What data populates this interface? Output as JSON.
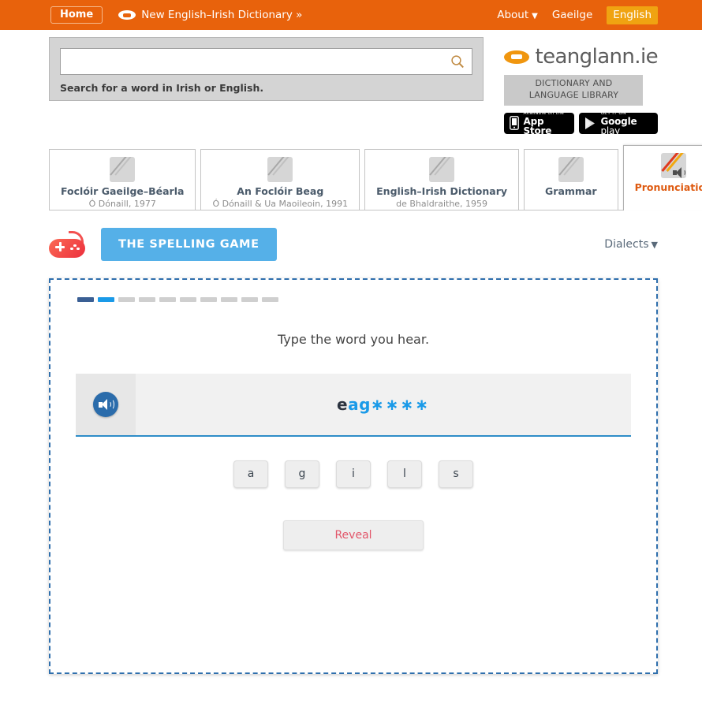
{
  "topbar": {
    "home_label": "Home",
    "breadcrumb_label": "New English–Irish Dictionary »",
    "about_label": "About",
    "about_caret": "▼",
    "lang_irish": "Gaeilge",
    "lang_english": "English",
    "bg_color": "#e8620c",
    "lang_active_color": "#f0a311"
  },
  "search": {
    "value": "",
    "placeholder": "",
    "hint": "Search for a word in Irish or English."
  },
  "brand": {
    "name": "teanglann.ie",
    "subtitle": "DICTIONARY AND LANGUAGE LIBRARY",
    "stores": [
      {
        "small": "Available on the",
        "big_bold": "App Store",
        "big_light": ""
      },
      {
        "small": "GET IT ON",
        "big_bold": "Google",
        "big_light": " play"
      }
    ]
  },
  "tabs": [
    {
      "name": "Foclóir Gaeilge–Béarla",
      "sub": "Ó Dónaill, 1977",
      "active": false
    },
    {
      "name": "An Foclóir Beag",
      "sub": "Ó Dónaill & Ua Maoileoin, 1991",
      "active": false
    },
    {
      "name": "English–Irish Dictionary",
      "sub": "de Bhaldraithe, 1959",
      "active": false
    },
    {
      "name": "Grammar",
      "sub": "",
      "active": false
    },
    {
      "name": "Pronunciation",
      "sub": "",
      "active": true
    }
  ],
  "game_header": {
    "button_label": "THE SPELLING GAME",
    "button_color": "#55b0e8",
    "dialects_label": "Dialects",
    "dialects_caret": "▼"
  },
  "game": {
    "progress": {
      "total": 10,
      "done": 1,
      "current": 2,
      "done_color": "#3a5f94",
      "current_color": "#1a9ae8",
      "empty_color": "#cfcfcf"
    },
    "prompt": "Type the word you hear.",
    "word": {
      "filled": "e",
      "typed": "ag",
      "blanks": "∗∗∗∗",
      "filled_color": "#2c3440",
      "typed_color": "#1a9ae8"
    },
    "letters": [
      "a",
      "g",
      "i",
      "l",
      "s"
    ],
    "reveal_label": "Reveal",
    "reveal_color": "#e2566a",
    "panel_border_color": "#2f6fad"
  }
}
